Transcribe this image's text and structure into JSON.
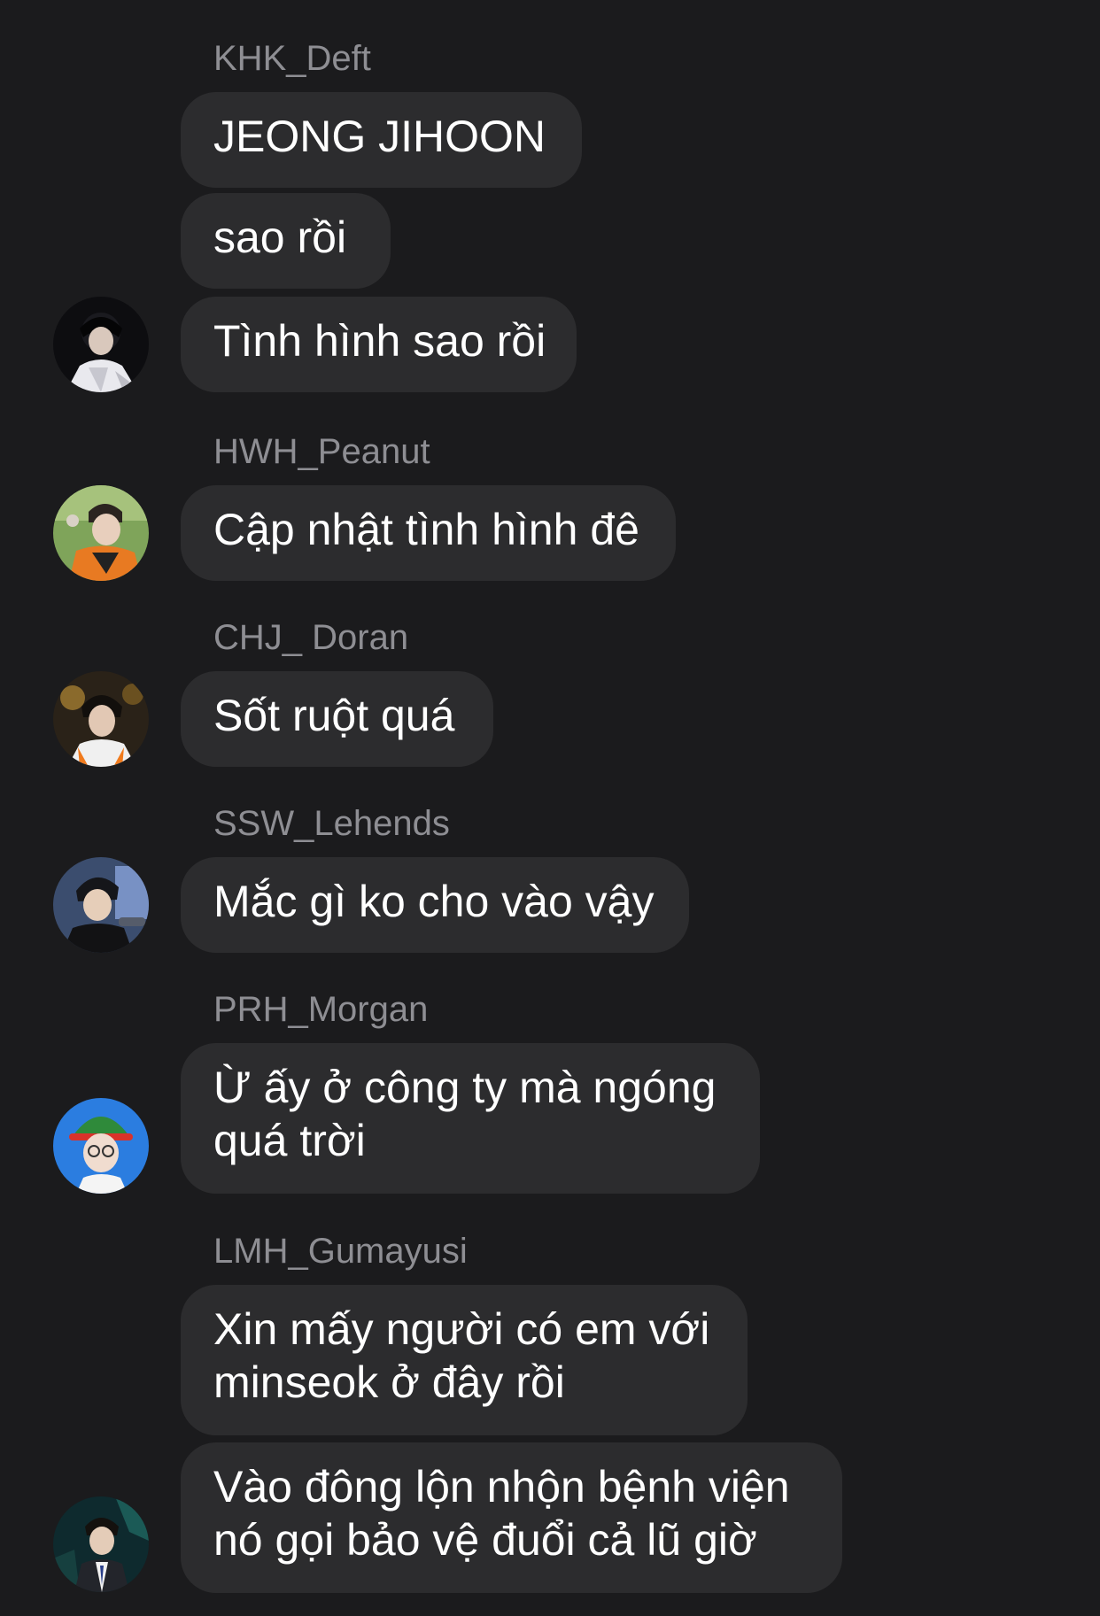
{
  "chat": {
    "messages": [
      {
        "sender": "KHK_Deft",
        "bubbles": [
          "JEONG JIHOON",
          "sao rồi",
          "Tình hình sao rồi"
        ],
        "avatar": "deft-avatar"
      },
      {
        "sender": "HWH_Peanut",
        "bubbles": [
          "Cập nhật tình hình đê"
        ],
        "avatar": "peanut-avatar"
      },
      {
        "sender": "CHJ_ Doran",
        "bubbles": [
          "Sốt ruột quá"
        ],
        "avatar": "doran-avatar"
      },
      {
        "sender": "SSW_Lehends",
        "bubbles": [
          "Mắc gì ko cho vào vậy"
        ],
        "avatar": "lehends-avatar"
      },
      {
        "sender": "PRH_Morgan",
        "bubbles": [
          [
            "Ừ ấy ở công ty mà ngóng",
            "quá trời"
          ]
        ],
        "avatar": "morgan-avatar"
      },
      {
        "sender": "LMH_Gumayusi",
        "bubbles": [
          [
            "Xin mấy người có em với",
            "minseok ở đây rồi"
          ],
          [
            "Vào đông lộn nhộn bệnh viện",
            "nó gọi bảo vệ đuổi cả lũ giờ"
          ]
        ],
        "avatar": "gumayusi-avatar"
      }
    ]
  },
  "colors": {
    "background": "#1b1b1d",
    "bubble": "#2c2c2e",
    "sender_text": "#8e8e93",
    "message_text": "#ffffff"
  }
}
